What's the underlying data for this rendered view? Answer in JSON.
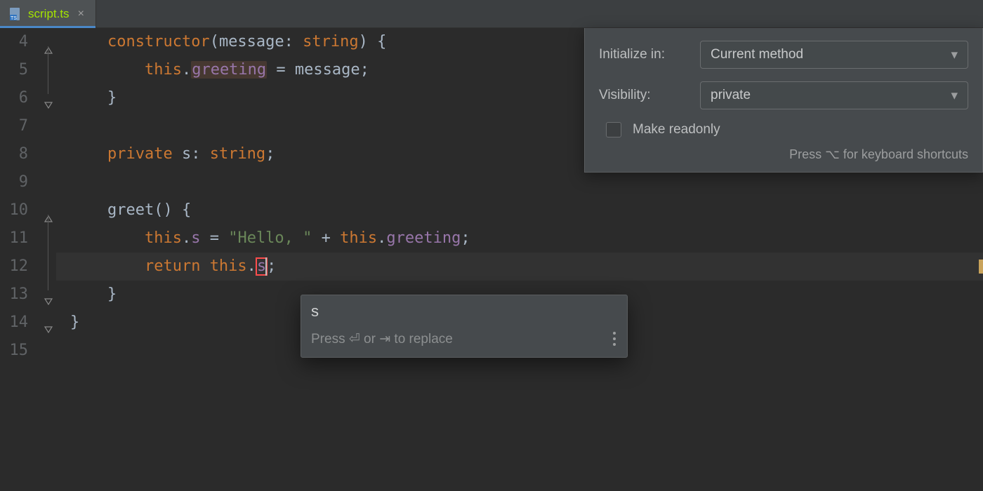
{
  "tab": {
    "filename": "script.ts"
  },
  "gutter": {
    "start": 4,
    "end": 15
  },
  "fold": {
    "lines": [
      {
        "row": 4,
        "from": 4,
        "to": 6
      },
      {
        "row": 6,
        "end": true
      },
      {
        "row": 10,
        "from": 10,
        "to": 13
      },
      {
        "row": 13,
        "end": true
      },
      {
        "row": 14,
        "end": true
      }
    ]
  },
  "code": {
    "lines": [
      {
        "n": 4,
        "indent": "    ",
        "tokens": [
          [
            "kw",
            "constructor"
          ],
          [
            "paren",
            "("
          ],
          [
            "id",
            "message"
          ],
          [
            "punc",
            ": "
          ],
          [
            "kw",
            "string"
          ],
          [
            "paren",
            ")"
          ],
          [
            "punc",
            " {"
          ]
        ]
      },
      {
        "n": 5,
        "indent": "        ",
        "tokens": [
          [
            "kw",
            "this"
          ],
          [
            "punc",
            "."
          ],
          [
            "field-hl",
            "greeting"
          ],
          [
            "punc",
            " = "
          ],
          [
            "id",
            "message"
          ],
          [
            "punc",
            ";"
          ]
        ]
      },
      {
        "n": 6,
        "indent": "    ",
        "tokens": [
          [
            "punc",
            "}"
          ]
        ]
      },
      {
        "n": 7,
        "indent": "",
        "tokens": []
      },
      {
        "n": 8,
        "indent": "    ",
        "tokens": [
          [
            "kw",
            "private "
          ],
          [
            "id",
            "s"
          ],
          [
            "punc",
            ": "
          ],
          [
            "kw",
            "string"
          ],
          [
            "punc",
            ";"
          ]
        ]
      },
      {
        "n": 9,
        "indent": "",
        "tokens": []
      },
      {
        "n": 10,
        "indent": "    ",
        "tokens": [
          [
            "id",
            "greet"
          ],
          [
            "paren",
            "()"
          ],
          [
            "punc",
            " {"
          ]
        ]
      },
      {
        "n": 11,
        "indent": "        ",
        "tokens": [
          [
            "kw",
            "this"
          ],
          [
            "punc",
            "."
          ],
          [
            "field",
            "s"
          ],
          [
            "punc",
            " = "
          ],
          [
            "str",
            "\"Hello, \""
          ],
          [
            "punc",
            " + "
          ],
          [
            "kw",
            "this"
          ],
          [
            "punc",
            "."
          ],
          [
            "field",
            "greeting"
          ],
          [
            "punc",
            ";"
          ]
        ]
      },
      {
        "n": 12,
        "indent": "        ",
        "active": true,
        "tokens": [
          [
            "kw",
            "return "
          ],
          [
            "kw",
            "this"
          ],
          [
            "punc",
            "."
          ],
          [
            "cursor",
            "s"
          ],
          [
            "punc",
            ";"
          ]
        ]
      },
      {
        "n": 13,
        "indent": "    ",
        "tokens": [
          [
            "punc",
            "}"
          ]
        ]
      },
      {
        "n": 14,
        "indent": "",
        "tokens": [
          [
            "punc",
            "}"
          ]
        ]
      },
      {
        "n": 15,
        "indent": "",
        "tokens": []
      }
    ]
  },
  "refactor": {
    "initialize_label": "Initialize in:",
    "initialize_value": "Current method",
    "visibility_label": "Visibility:",
    "visibility_value": "private",
    "readonly_label": "Make readonly",
    "hint": "Press ⌥ for keyboard shortcuts"
  },
  "rename": {
    "value": "s",
    "hint": "Press ⏎ or ⇥ to replace"
  }
}
